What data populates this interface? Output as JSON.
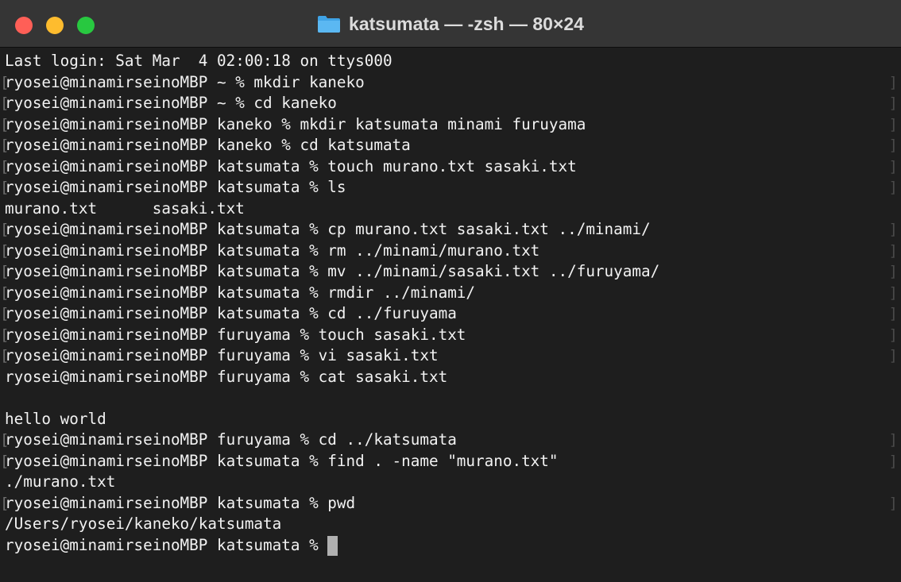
{
  "window": {
    "title": "katsumata — -zsh — 80×24",
    "folder_icon": "folder-icon",
    "controls": [
      "close-button",
      "minimize-button",
      "zoom-button"
    ]
  },
  "terminal": {
    "lines": [
      {
        "text": "Last login: Sat Mar  4 02:00:18 on ttys000",
        "marked": false
      },
      {
        "text": "ryosei@minamirseinoMBP ~ % mkdir kaneko",
        "marked": true
      },
      {
        "text": "ryosei@minamirseinoMBP ~ % cd kaneko",
        "marked": true
      },
      {
        "text": "ryosei@minamirseinoMBP kaneko % mkdir katsumata minami furuyama",
        "marked": true
      },
      {
        "text": "ryosei@minamirseinoMBP kaneko % cd katsumata",
        "marked": true
      },
      {
        "text": "ryosei@minamirseinoMBP katsumata % touch murano.txt sasaki.txt",
        "marked": true
      },
      {
        "text": "ryosei@minamirseinoMBP katsumata % ls",
        "marked": true
      },
      {
        "text": "murano.txt      sasaki.txt",
        "marked": false
      },
      {
        "text": "ryosei@minamirseinoMBP katsumata % cp murano.txt sasaki.txt ../minami/",
        "marked": true
      },
      {
        "text": "ryosei@minamirseinoMBP katsumata % rm ../minami/murano.txt",
        "marked": true
      },
      {
        "text": "ryosei@minamirseinoMBP katsumata % mv ../minami/sasaki.txt ../furuyama/",
        "marked": true
      },
      {
        "text": "ryosei@minamirseinoMBP katsumata % rmdir ../minami/",
        "marked": true
      },
      {
        "text": "ryosei@minamirseinoMBP katsumata % cd ../furuyama",
        "marked": true
      },
      {
        "text": "ryosei@minamirseinoMBP furuyama % touch sasaki.txt",
        "marked": true
      },
      {
        "text": "ryosei@minamirseinoMBP furuyama % vi sasaki.txt",
        "marked": true
      },
      {
        "text": "ryosei@minamirseinoMBP furuyama % cat sasaki.txt",
        "marked": false
      },
      {
        "text": "",
        "marked": false
      },
      {
        "text": "hello world",
        "marked": false
      },
      {
        "text": "ryosei@minamirseinoMBP furuyama % cd ../katsumata",
        "marked": true
      },
      {
        "text": "ryosei@minamirseinoMBP katsumata % find . -name \"murano.txt\"",
        "marked": true
      },
      {
        "text": "./murano.txt",
        "marked": false
      },
      {
        "text": "ryosei@minamirseinoMBP katsumata % pwd",
        "marked": true
      },
      {
        "text": "/Users/ryosei/kaneko/katsumata",
        "marked": false
      },
      {
        "text": "ryosei@minamirseinoMBP katsumata % ",
        "marked": false
      }
    ],
    "cursor_row": 23
  }
}
